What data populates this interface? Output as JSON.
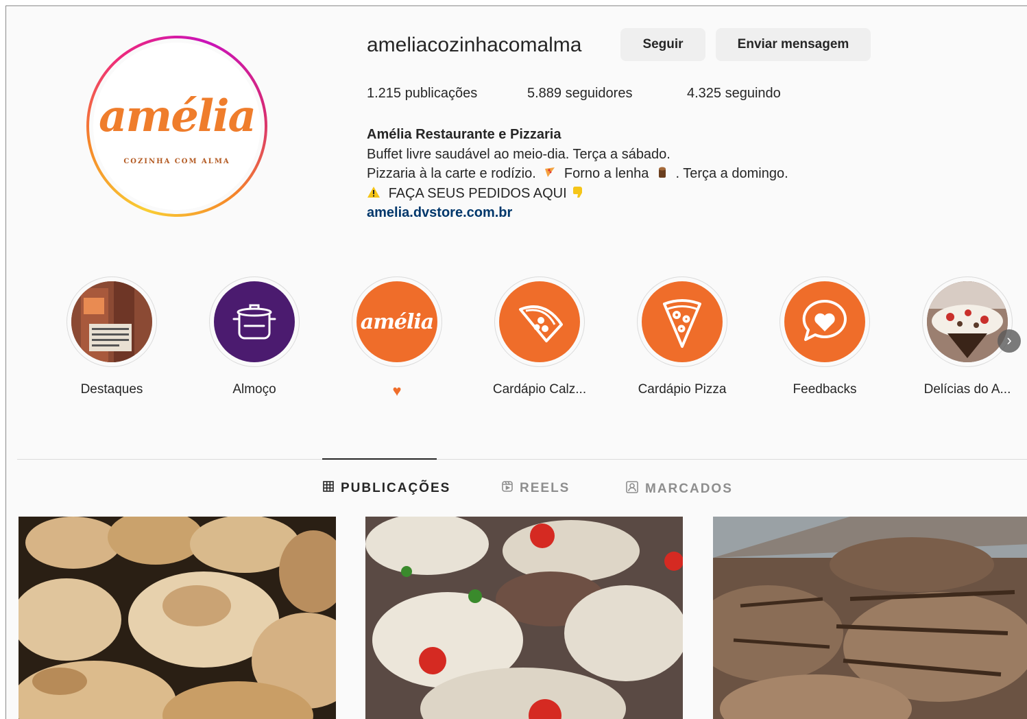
{
  "profile": {
    "username": "ameliacozinhacomalma",
    "follow_label": "Seguir",
    "message_label": "Enviar mensagem",
    "logo_word": "amélia",
    "logo_sub": "COZINHA COM ALMA",
    "stats": {
      "posts": "1.215 publicações",
      "followers": "5.889 seguidores",
      "following": "4.325 seguindo"
    },
    "bio": {
      "name": "Amélia Restaurante e Pizzaria",
      "line1": "Buffet livre saudável ao meio-dia. Terça a sábado.",
      "line2_a": "Pizzaria à la carte e rodízio.",
      "line2_b": "Forno a lenha",
      "line2_c": ". Terça a domingo.",
      "line3": "FAÇA SEUS PEDIDOS AQUI",
      "link": "amelia.dvstore.com.br"
    }
  },
  "highlights": [
    {
      "label": "Destaques",
      "icon": "storefront-photo"
    },
    {
      "label": "Almoço",
      "icon": "cooking-pot-icon"
    },
    {
      "label": "",
      "icon": "amelia-logo",
      "heart": "♥"
    },
    {
      "label": "Cardápio Calz...",
      "icon": "calzone-icon"
    },
    {
      "label": "Cardápio Pizza",
      "icon": "pizza-slice-icon"
    },
    {
      "label": "Feedbacks",
      "icon": "heart-speech-bubble-icon"
    },
    {
      "label": "Delícias do A...",
      "icon": "dessert-photo"
    }
  ],
  "highlight_logo_text": "amélia",
  "tabs": [
    {
      "label": "PUBLICAÇÕES",
      "icon": "grid-icon",
      "active": true
    },
    {
      "label": "REELS",
      "icon": "reels-icon",
      "active": false
    },
    {
      "label": "MARCADOS",
      "icon": "tagged-icon",
      "active": false
    }
  ],
  "posts": [
    {
      "subject": "stuffed-potatoes-photo"
    },
    {
      "subject": "stuffed-mushrooms-photo"
    },
    {
      "subject": "grilled-meat-photo"
    }
  ],
  "colors": {
    "brand_orange": "#ef6d2a",
    "highlight_purple": "#4b1b6f",
    "link_blue": "#00376b"
  }
}
